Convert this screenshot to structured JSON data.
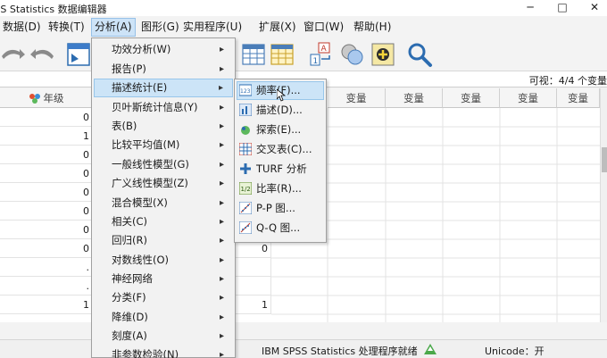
{
  "window": {
    "title": "IBM SPSS Statistics 数据编辑器",
    "min_label": "─",
    "max_label": "□",
    "close_label": "✕"
  },
  "menubar": [
    {
      "label": "数据(D)",
      "active": false
    },
    {
      "label": "转换(T)",
      "active": false
    },
    {
      "label": "分析(A)",
      "active": true
    },
    {
      "label": "图形(G)",
      "active": false
    },
    {
      "label": "实用程序(U)",
      "active": false
    },
    {
      "label": "扩展(X)",
      "active": false
    },
    {
      "label": "窗口(W)",
      "active": false
    },
    {
      "label": "帮助(H)",
      "active": false
    }
  ],
  "toolbar": {
    "icons": [
      "undo-icon",
      "redo-icon",
      "goto-case-icon",
      "grid-table-icon",
      "variables-icon",
      "value-labels-icon",
      "use-sets-icon",
      "spelling-icon",
      "search-icon"
    ]
  },
  "inputrow": {
    "visible_text": "可视：4/4 个变量"
  },
  "grid": {
    "first_header": "年级",
    "var_header": "变量",
    "rows": [
      "0",
      "1",
      "0",
      "0",
      "0",
      "0",
      "0",
      "0",
      ".",
      ".",
      "1"
    ],
    "center_col": [
      "",
      "",
      "",
      "",
      "",
      "",
      "",
      "",
      "0",
      "",
      "1"
    ]
  },
  "analysis_menu": {
    "items": [
      {
        "label": "功效分析(W)",
        "submenu": true
      },
      {
        "label": "报告(P)",
        "submenu": true
      },
      {
        "label": "描述统计(E)",
        "submenu": true,
        "highlighted": true
      },
      {
        "label": "贝叶斯统计信息(Y)",
        "submenu": true
      },
      {
        "label": "表(B)",
        "submenu": true
      },
      {
        "label": "比较平均值(M)",
        "submenu": true
      },
      {
        "label": "一般线性模型(G)",
        "submenu": true
      },
      {
        "label": "广义线性模型(Z)",
        "submenu": true
      },
      {
        "label": "混合模型(X)",
        "submenu": true
      },
      {
        "label": "相关(C)",
        "submenu": true
      },
      {
        "label": "回归(R)",
        "submenu": true
      },
      {
        "label": "对数线性(O)",
        "submenu": true
      },
      {
        "label": "神经网络",
        "submenu": true
      },
      {
        "label": "分类(F)",
        "submenu": true
      },
      {
        "label": "降维(D)",
        "submenu": true
      },
      {
        "label": "刻度(A)",
        "submenu": true
      },
      {
        "label": "非参数检验(N)",
        "submenu": true
      }
    ]
  },
  "descriptives_menu": {
    "items": [
      {
        "label": "频率(F)...",
        "icon": "frequencies-icon",
        "highlighted": true
      },
      {
        "label": "描述(D)...",
        "icon": "descriptives-icon"
      },
      {
        "label": "探索(E)...",
        "icon": "explore-icon"
      },
      {
        "label": "交叉表(C)...",
        "icon": "crosstabs-icon"
      },
      {
        "label": "TURF 分析",
        "icon": "turf-icon"
      },
      {
        "label": "比率(R)...",
        "icon": "ratio-icon"
      },
      {
        "label": "P-P 图...",
        "icon": "pp-plot-icon"
      },
      {
        "label": "Q-Q 图...",
        "icon": "qq-plot-icon"
      }
    ]
  },
  "statusbar": {
    "processor": "IBM SPSS Statistics 处理程序就绪",
    "unicode": "Unicode：开"
  }
}
